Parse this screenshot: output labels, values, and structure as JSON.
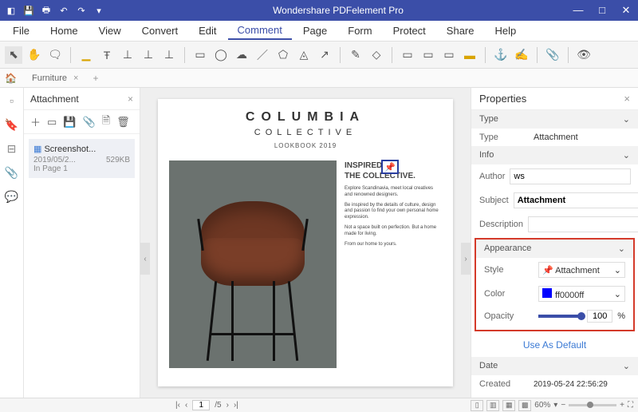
{
  "titlebar": {
    "title": "Wondershare PDFelement Pro"
  },
  "menu": [
    "File",
    "Home",
    "View",
    "Convert",
    "Edit",
    "Comment",
    "Page",
    "Form",
    "Protect",
    "Share",
    "Help"
  ],
  "menu_active": 5,
  "tab": {
    "name": "Furniture"
  },
  "attach": {
    "title": "Attachment",
    "item": {
      "name": "Screenshot...",
      "date": "2019/05/2...",
      "size": "529KB",
      "page": "In Page 1"
    }
  },
  "doc": {
    "brand": "COLUMBIA",
    "brand2": "COLLECTIVE",
    "tagline": "LOOKBOOK 2019",
    "headline1": "INSPIRED BY",
    "headline2": "THE COLLECTIVE.",
    "p1": "Explore Scandinavia, meet local creatives and renowned designers.",
    "p2": "Be inspired by the details of culture, design and passion to find your own personal home expression.",
    "p3": "Not a space built on perfection. But a home made for living.",
    "p4": "From our home to yours."
  },
  "props": {
    "title": "Properties",
    "sections": {
      "type": "Type",
      "info": "Info",
      "appearance": "Appearance",
      "date": "Date"
    },
    "labels": {
      "type": "Type",
      "author": "Author",
      "subject": "Subject",
      "description": "Description",
      "style": "Style",
      "color": "Color",
      "opacity": "Opacity",
      "created": "Created"
    },
    "values": {
      "type": "Attachment",
      "author": "ws",
      "subject": "Attachment",
      "style": "Attachment",
      "color": "ff0000ff",
      "opacity": "100",
      "created": "2019-05-24 22:56:29"
    },
    "default_btn": "Use As Default",
    "pct": "%"
  },
  "status": {
    "page": "1",
    "total": "/5",
    "zoom": "60%"
  }
}
